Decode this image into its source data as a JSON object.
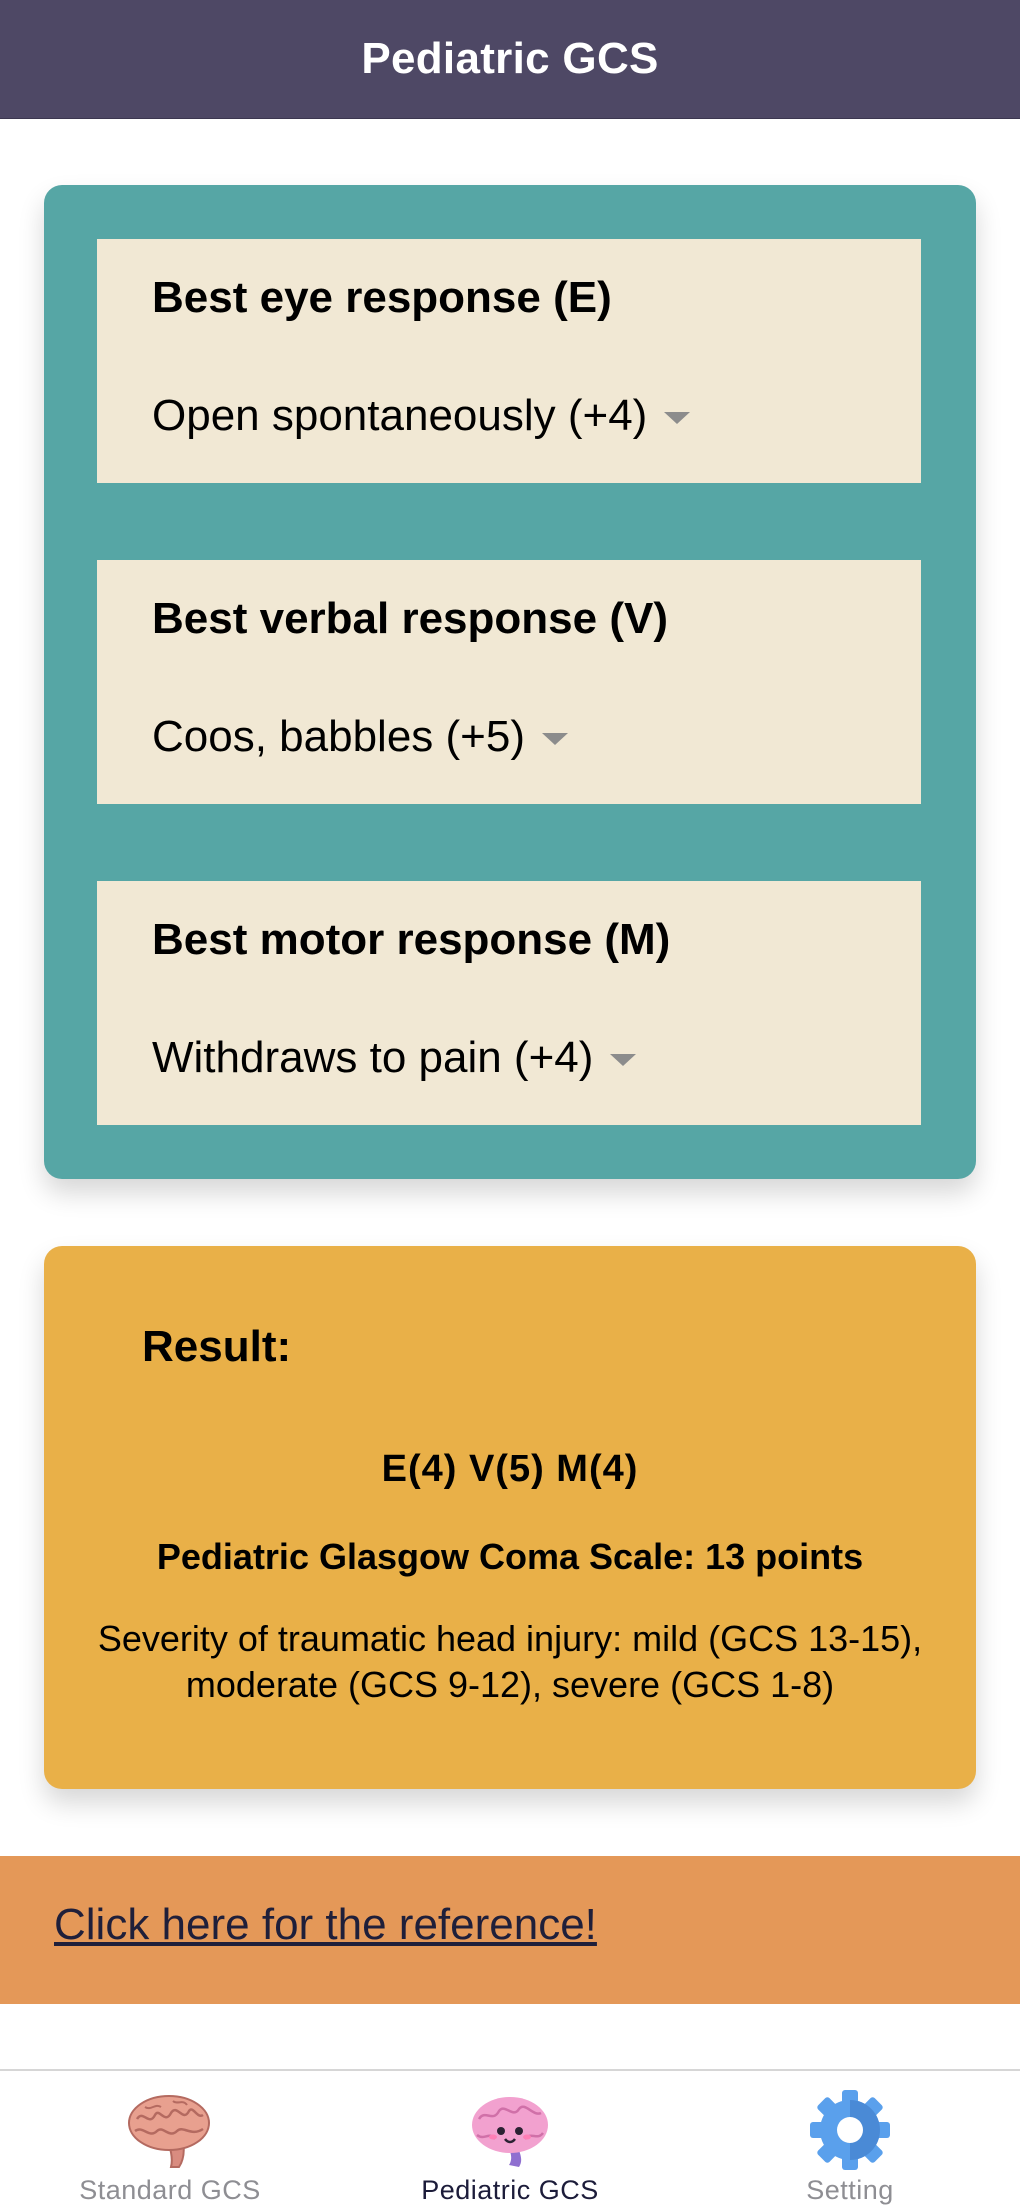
{
  "header": {
    "title": "Pediatric GCS"
  },
  "questions": [
    {
      "title": "Best eye response (E)",
      "value": "Open spontaneously (+4)"
    },
    {
      "title": "Best verbal response (V)",
      "value": "Coos, babbles (+5)"
    },
    {
      "title": "Best motor response (M)",
      "value": "Withdraws to pain (+4)"
    }
  ],
  "result": {
    "label": "Result:",
    "scores": "E(4) V(5) M(4)",
    "total": "Pediatric Glasgow Coma Scale: 13 points",
    "severity": "Severity of traumatic head injury: mild (GCS 13-15), moderate (GCS 9-12), severe (GCS 1-8)"
  },
  "reference": {
    "link_text": "Click here for the reference!"
  },
  "tabbar": {
    "active_tab": "Pediatric GCS",
    "tabs": [
      {
        "label": "Standard GCS",
        "icon": "brain-icon"
      },
      {
        "label": "Pediatric GCS",
        "icon": "pink-brain-icon"
      },
      {
        "label": "Setting",
        "icon": "gear-icon"
      }
    ]
  },
  "colors": {
    "header_bg": "#4e4865",
    "panel_teal": "#56a6a5",
    "card_beige": "#f1e8d4",
    "result_yellow": "#e9b048",
    "reference_orange": "#e49858",
    "tab_active": "#1c1c3a",
    "tab_inactive": "#8e8e93"
  }
}
